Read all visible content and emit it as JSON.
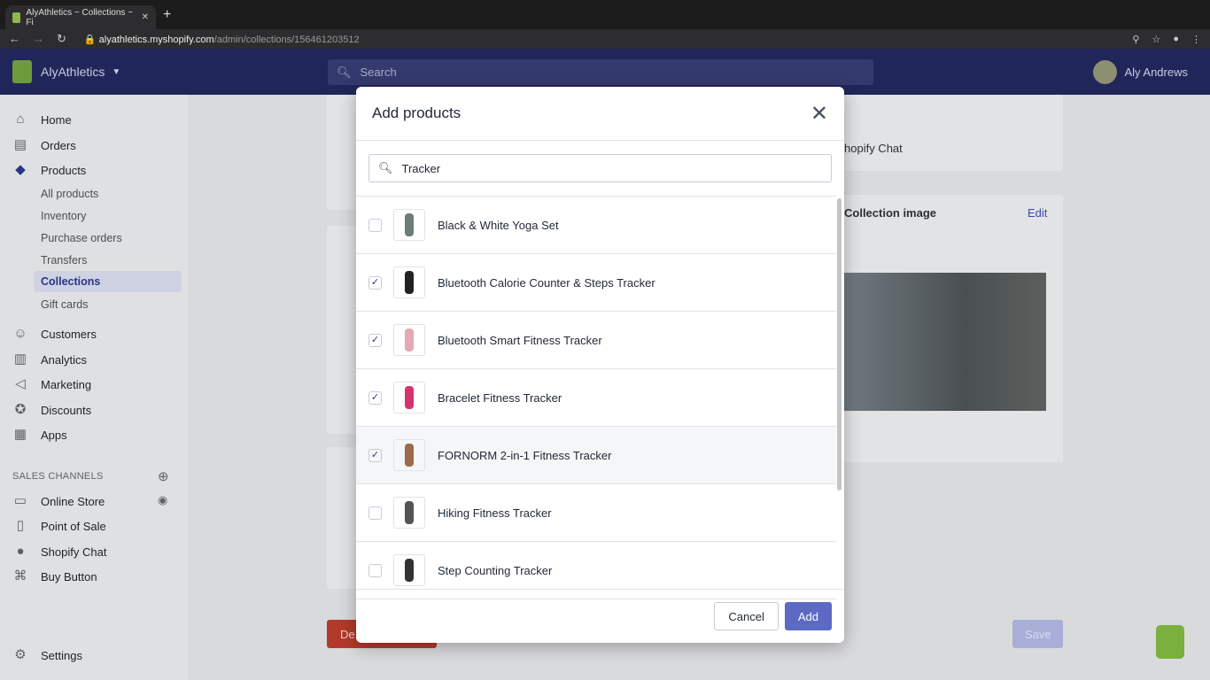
{
  "browser": {
    "tab_title": "AlyAthletics ~ Collections ~ Fi",
    "url_host": "alyathletics.myshopify.com",
    "url_path": "/admin/collections/156461203512"
  },
  "topbar": {
    "store_name": "AlyAthletics",
    "search_placeholder": "Search",
    "user_name": "Aly Andrews"
  },
  "sidebar": {
    "items": [
      {
        "label": "Home",
        "icon": "home-icon"
      },
      {
        "label": "Orders",
        "icon": "orders-icon"
      },
      {
        "label": "Products",
        "icon": "tag-icon"
      }
    ],
    "product_subitems": [
      "All products",
      "Inventory",
      "Purchase orders",
      "Transfers",
      "Collections",
      "Gift cards"
    ],
    "items2": [
      {
        "label": "Customers",
        "icon": "person-icon"
      },
      {
        "label": "Analytics",
        "icon": "chart-icon"
      },
      {
        "label": "Marketing",
        "icon": "megaphone-icon"
      },
      {
        "label": "Discounts",
        "icon": "discount-icon"
      },
      {
        "label": "Apps",
        "icon": "apps-icon"
      }
    ],
    "sales_channels_label": "SALES CHANNELS",
    "channels": [
      "Online Store",
      "Point of Sale",
      "Shopify Chat",
      "Buy Button"
    ],
    "settings": "Settings"
  },
  "background": {
    "shopify_chat": "hopify Chat",
    "collection_image": "Collection image",
    "edit": "Edit",
    "delete": "De",
    "save": "Save"
  },
  "modal": {
    "title": "Add products",
    "search_value": "Tracker",
    "cancel": "Cancel",
    "add": "Add",
    "products": [
      {
        "name": "Black & White Yoga Set",
        "checked": false,
        "color": "#6b7d78"
      },
      {
        "name": "Bluetooth Calorie Counter & Steps Tracker",
        "checked": true,
        "color": "#222"
      },
      {
        "name": "Bluetooth Smart Fitness Tracker",
        "checked": true,
        "color": "#e4a9b4"
      },
      {
        "name": "Bracelet Fitness Tracker",
        "checked": true,
        "color": "#d8336f"
      },
      {
        "name": "FORNORM 2-in-1 Fitness Tracker",
        "checked": true,
        "color": "#9a6a4a"
      },
      {
        "name": "Hiking Fitness Tracker",
        "checked": false,
        "color": "#555"
      },
      {
        "name": "Step Counting Tracker",
        "checked": false,
        "color": "#333"
      }
    ]
  }
}
